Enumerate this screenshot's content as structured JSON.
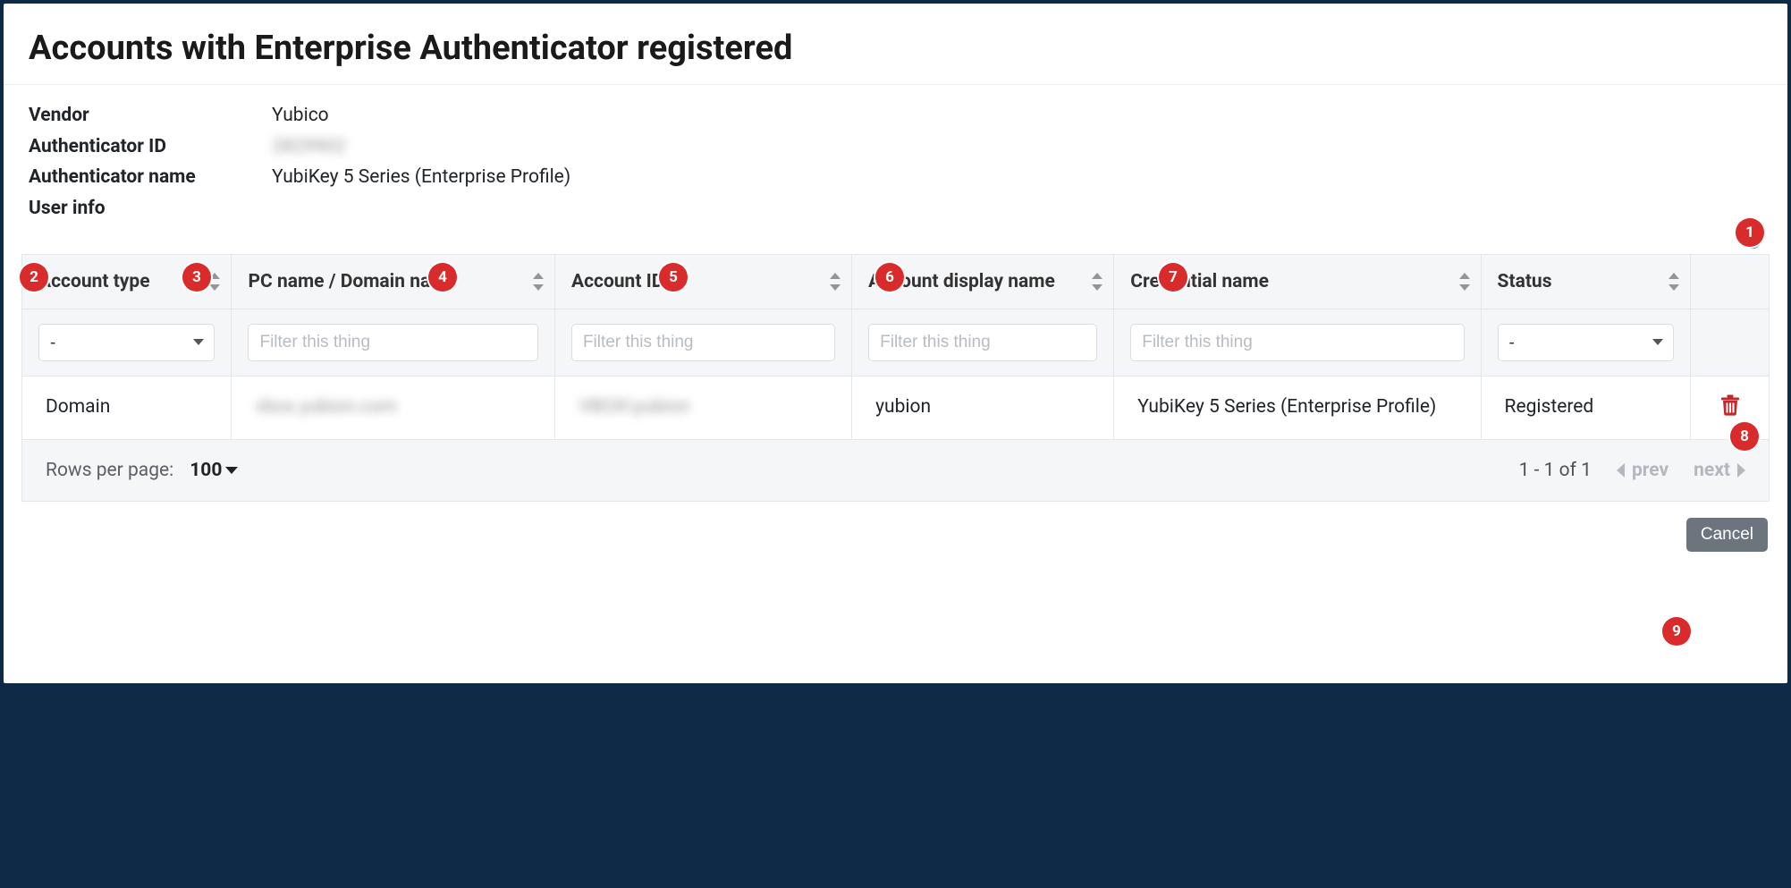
{
  "title": "Accounts with Enterprise Authenticator registered",
  "details": {
    "vendor_label": "Vendor",
    "vendor_value": "Yubico",
    "auth_id_label": "Authenticator ID",
    "auth_id_value": "2829902",
    "auth_name_label": "Authenticator name",
    "auth_name_value": "YubiKey 5 Series (Enterprise Profile)",
    "user_info_label": "User info",
    "user_info_value": ""
  },
  "columns": {
    "account_type": "Account type",
    "pc_domain": "PC name / Domain name",
    "account_id": "Account ID",
    "display_name": "Account display name",
    "credential_name": "Credential name",
    "status": "Status"
  },
  "filters": {
    "placeholder": "Filter this thing",
    "account_type_selected": "-",
    "status_selected": "-"
  },
  "rows": [
    {
      "account_type": "Domain",
      "pc_domain": "vbox.yubion.com",
      "account_id": "VBOX\\yubion",
      "display_name": "yubion",
      "credential_name": "YubiKey 5 Series (Enterprise Profile)",
      "status": "Registered"
    }
  ],
  "pagination": {
    "rpp_label": "Rows per page:",
    "rpp_value": "100",
    "range": "1 - 1 of 1",
    "prev": "prev",
    "next": "next"
  },
  "buttons": {
    "cancel": "Cancel"
  },
  "markers": [
    "1",
    "2",
    "3",
    "4",
    "5",
    "6",
    "7",
    "8",
    "9"
  ]
}
